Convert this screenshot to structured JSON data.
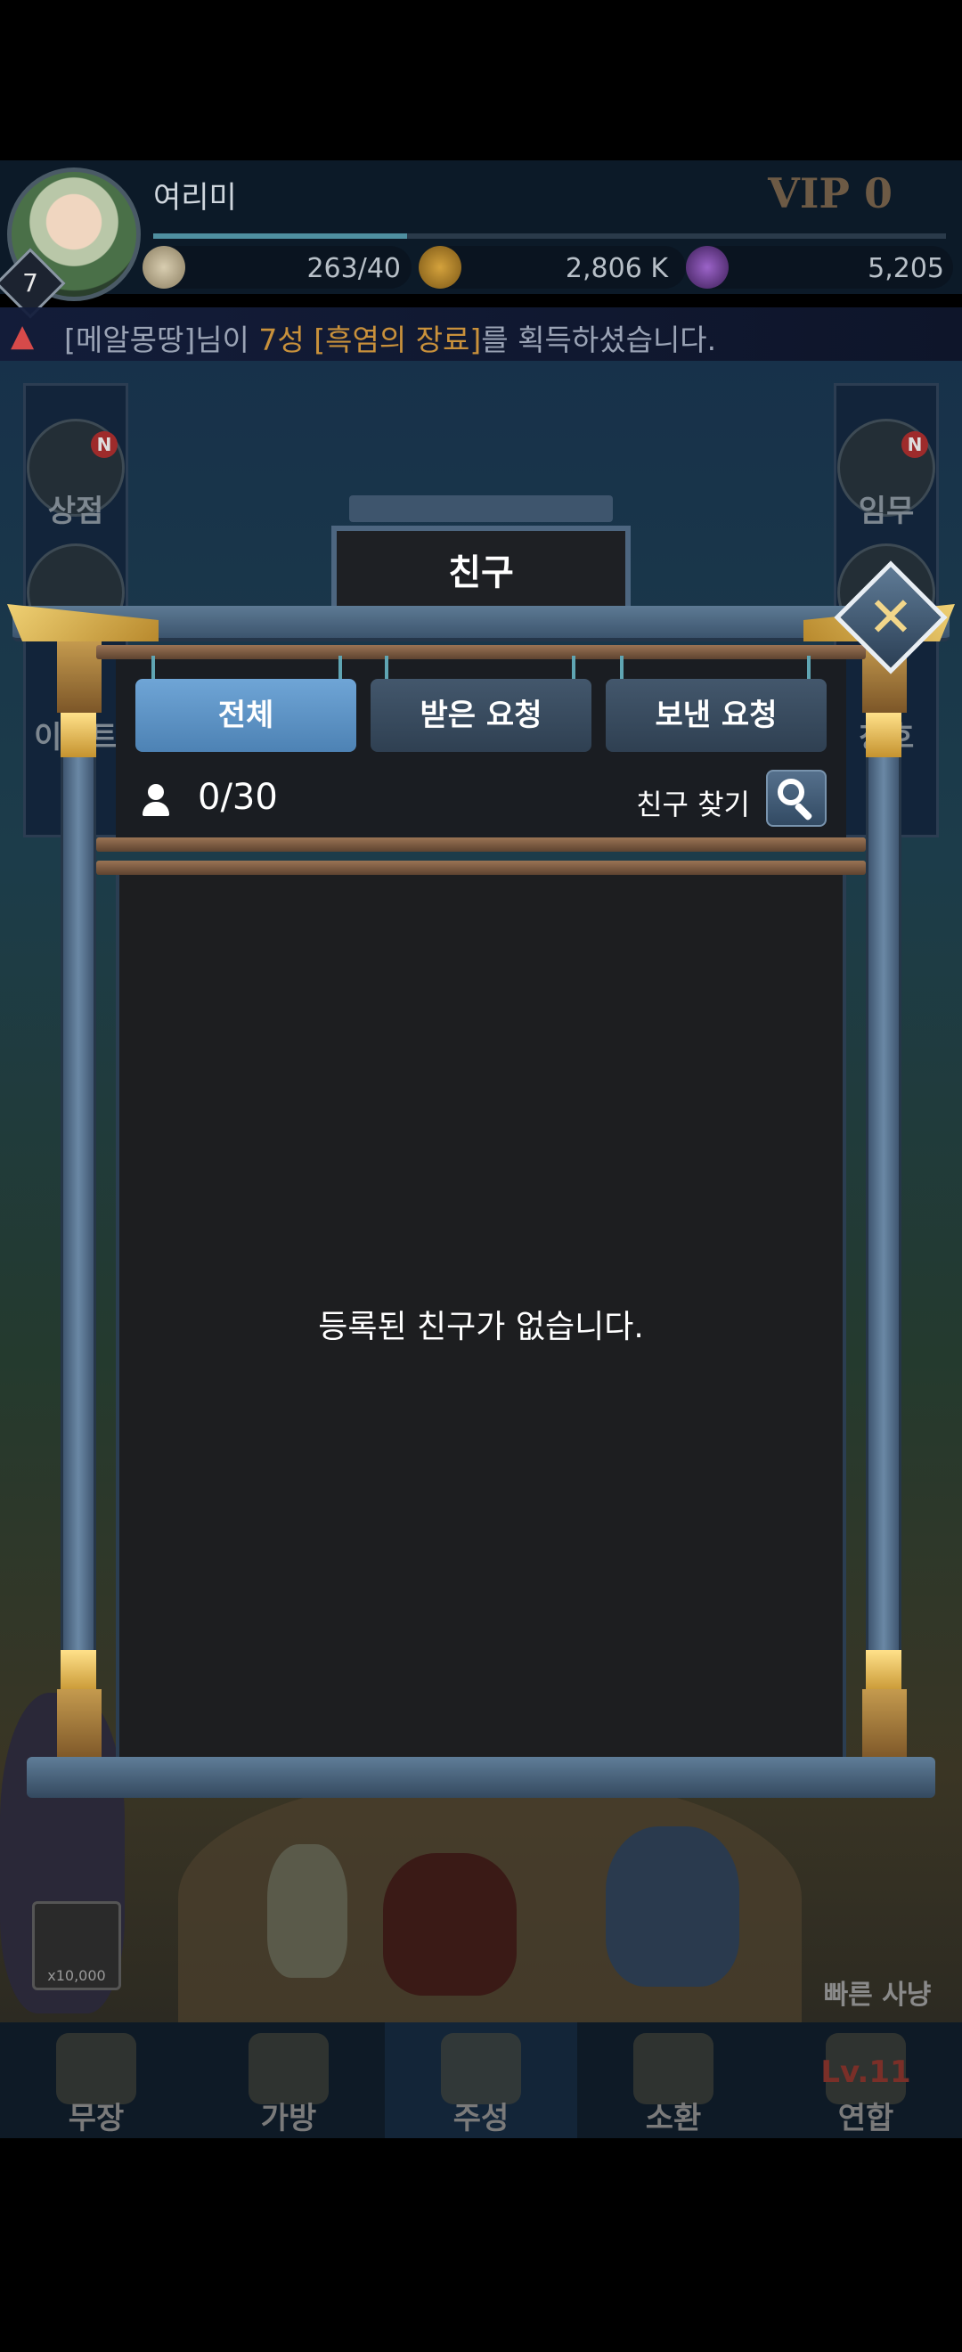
{
  "header": {
    "player_name": "여리미",
    "level": "7",
    "vip": "VIP  0",
    "exp_fraction": 0.32,
    "resources": [
      {
        "icon": "rice-bun-icon",
        "value": "263/40"
      },
      {
        "icon": "gold-coin-icon",
        "value": "2,806 K"
      },
      {
        "icon": "purple-gem-icon",
        "value": "5,205"
      }
    ]
  },
  "notice": {
    "prefix": "[메알몽땅]님이 ",
    "grade": "7성",
    "item": " [흑염의 장료]",
    "suffix": "를 획득하셨습니다."
  },
  "side_left": [
    {
      "label": "상점",
      "badge": "N"
    },
    {
      "label": "이벤트"
    }
  ],
  "side_right": [
    {
      "label": "임무",
      "badge": "N"
    },
    {
      "label": "칭호"
    }
  ],
  "popup": {
    "title": "친구",
    "tabs": [
      "전체",
      "받은 요청",
      "보낸 요청"
    ],
    "active_tab": 0,
    "friend_count": "0/30",
    "find_label": "친구 찾기",
    "empty_message": "등록된 친구가 없습니다."
  },
  "quick_slot": {
    "count": "x10,000"
  },
  "fast_hunt": {
    "label": "빠른 사냥"
  },
  "bottom_nav": {
    "items": [
      "무장",
      "가방",
      "주성",
      "소환",
      "연합"
    ],
    "active": 2,
    "lv_badge": "Lv.11"
  }
}
